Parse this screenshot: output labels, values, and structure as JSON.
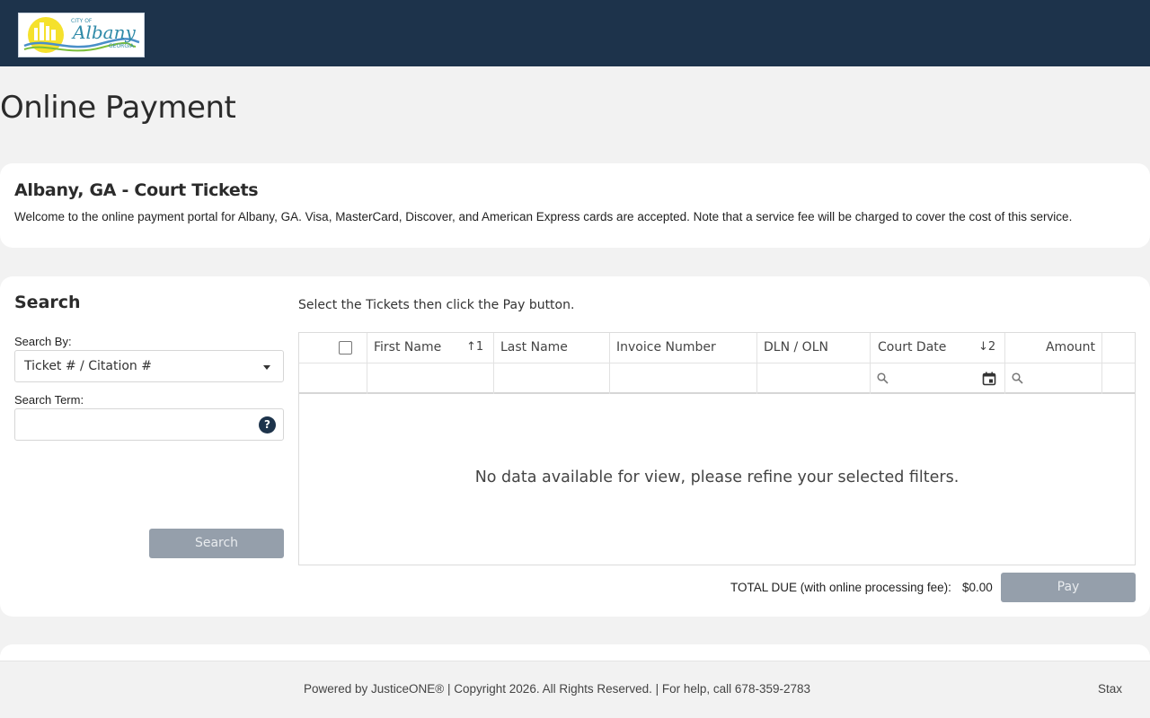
{
  "header": {
    "logo": {
      "icon": "city-of-albany-logo",
      "line1": "CITY OF",
      "line2": "Albany",
      "line3": "GEORGIA",
      "colors": {
        "navy": "#1d334b",
        "sun": "#f5e12c",
        "wave_blue": "#4a8fc8",
        "wave_green": "#7bbf3a",
        "teal_text": "#2f8aa8"
      }
    }
  },
  "page": {
    "title": "Online Payment"
  },
  "intro": {
    "heading": "Albany, GA - Court Tickets",
    "text": "Welcome to the online payment portal for Albany, GA. Visa, MasterCard, Discover, and American Express cards are accepted. Note that a service fee will be charged to cover the cost of this service."
  },
  "search": {
    "heading": "Search",
    "by_label": "Search By:",
    "by_value": "Ticket # / Citation #",
    "term_label": "Search Term:",
    "term_value": "",
    "help_glyph": "?",
    "button_label": "Search"
  },
  "results": {
    "instruction": "Select the Tickets then click the Pay button.",
    "columns": [
      {
        "label": "",
        "sort": ""
      },
      {
        "label": "First Name",
        "sort": "↑1"
      },
      {
        "label": "Last Name",
        "sort": ""
      },
      {
        "label": "Invoice Number",
        "sort": ""
      },
      {
        "label": "DLN / OLN",
        "sort": ""
      },
      {
        "label": "Court Date",
        "sort": "↓2"
      },
      {
        "label": "Amount",
        "sort": ""
      }
    ],
    "empty_message": "No data available for view, please refine your selected filters."
  },
  "totals": {
    "label": "TOTAL DUE (with online processing fee):",
    "value": "$0.00",
    "pay_label": "Pay"
  },
  "footer": {
    "text": "Powered by JusticeONE® | Copyright 2026. All Rights Reserved. | For help, call 678-359-2783",
    "right": "Stax"
  },
  "colors": {
    "header_bg": "#1d334b",
    "page_bg": "#f2f2f2",
    "disabled_button": "#959fab"
  }
}
